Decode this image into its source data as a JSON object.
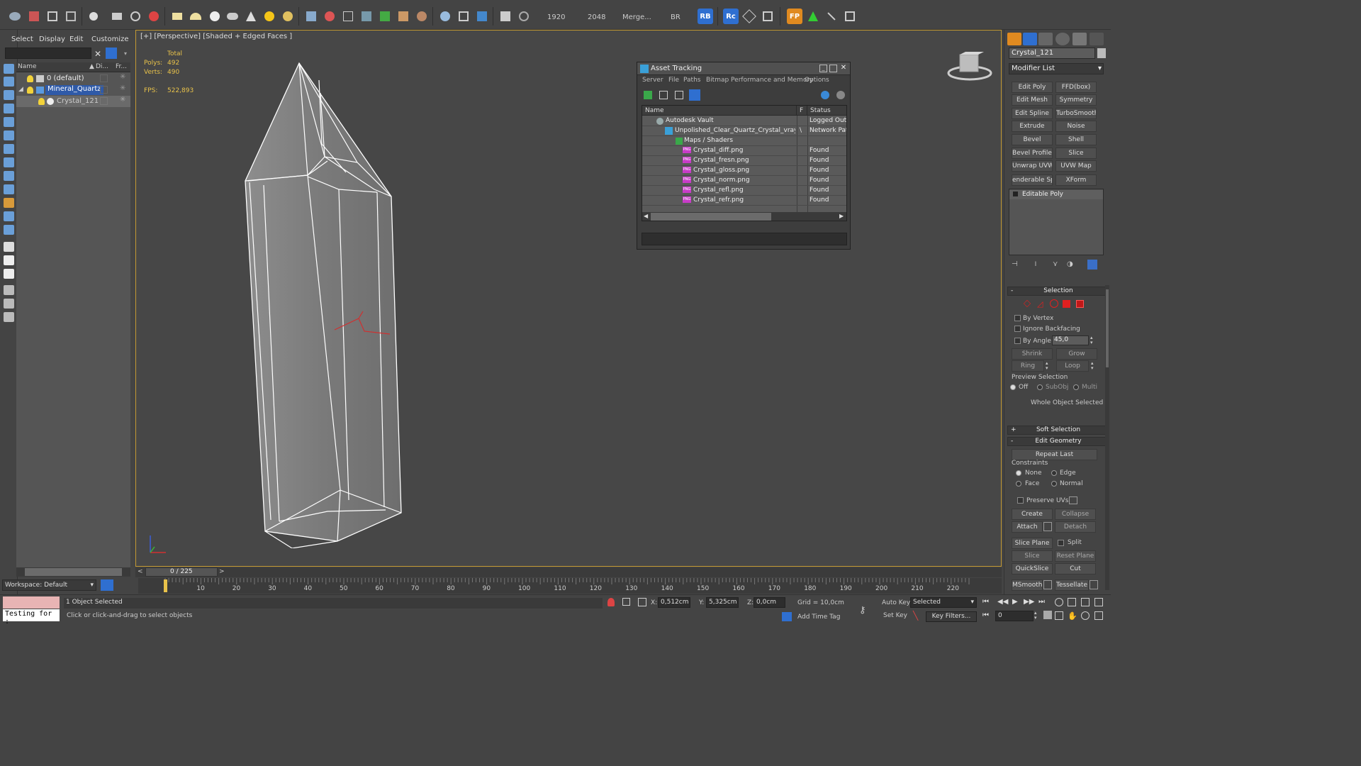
{
  "toolbar": {
    "render_width": "1920",
    "render_height": "2048",
    "merge_label": "Merge...",
    "br_label": "BR",
    "rb_label": "RB",
    "rc_label": "Rc",
    "fp_label": "FP"
  },
  "scene_explorer": {
    "menu": [
      "Select",
      "Display",
      "Edit",
      "Customize"
    ],
    "columns": {
      "name": "Name",
      "display": "Di...",
      "freeze": "Fr..."
    },
    "rows": [
      {
        "label": "0 (default)",
        "selected": false
      },
      {
        "label": "Mineral_Quartz",
        "selected": true
      },
      {
        "label": "Crystal_121",
        "selected": false
      }
    ],
    "workspace": "Workspace: Default"
  },
  "viewport": {
    "label": "[+] [Perspective] [Shaded + Edged Faces ]",
    "stats": {
      "total_label": "Total",
      "polys_label": "Polys:",
      "polys_value": "492",
      "verts_label": "Verts:",
      "verts_value": "490",
      "fps_label": "FPS:",
      "fps_value": "522,893"
    }
  },
  "asset_tracking": {
    "title": "Asset Tracking",
    "menu": [
      "Server",
      "File",
      "Paths",
      "Bitmap Performance and Memory",
      "Options"
    ],
    "columns": {
      "name": "Name",
      "flag": "F",
      "status": "Status"
    },
    "rows": [
      {
        "name": "Autodesk Vault",
        "flag": "",
        "status": "Logged Out (",
        "type": "vault"
      },
      {
        "name": "Unpolished_Clear_Quartz_Crystal_vray....",
        "flag": "\\",
        "status": "Network Path",
        "type": "max"
      },
      {
        "name": "Maps / Shaders",
        "flag": "",
        "status": "",
        "type": "folder"
      },
      {
        "name": "Crystal_diff.png",
        "flag": "",
        "status": "Found",
        "type": "png"
      },
      {
        "name": "Crystal_fresn.png",
        "flag": "",
        "status": "Found",
        "type": "png"
      },
      {
        "name": "Crystal_gloss.png",
        "flag": "",
        "status": "Found",
        "type": "png"
      },
      {
        "name": "Crystal_norm.png",
        "flag": "",
        "status": "Found",
        "type": "png"
      },
      {
        "name": "Crystal_refl.png",
        "flag": "",
        "status": "Found",
        "type": "png"
      },
      {
        "name": "Crystal_refr.png",
        "flag": "",
        "status": "Found",
        "type": "png"
      }
    ]
  },
  "command_panel": {
    "object_name": "Crystal_121",
    "modifier_list": "Modifier List",
    "modifier_buttons": [
      [
        "Edit Poly",
        "FFD(box)"
      ],
      [
        "Edit Mesh",
        "Symmetry"
      ],
      [
        "Edit Spline",
        "TurboSmooth"
      ],
      [
        "Extrude",
        "Noise"
      ],
      [
        "Bevel",
        "Shell"
      ],
      [
        "Bevel Profile",
        "Slice"
      ],
      [
        "Unwrap UVW",
        "UVW Map"
      ],
      [
        "enderable Splir",
        "XForm"
      ]
    ],
    "stack_item": "Editable Poly",
    "selection": {
      "title": "Selection",
      "by_vertex": "By Vertex",
      "ignore_backfacing": "Ignore Backfacing",
      "by_angle": "By Angle:",
      "angle_value": "45,0",
      "shrink": "Shrink",
      "grow": "Grow",
      "ring": "Ring",
      "loop": "Loop",
      "preview_selection": "Preview Selection",
      "preview_off": "Off",
      "preview_subobj": "SubObj",
      "preview_multi": "Multi",
      "whole_object": "Whole Object Selected"
    },
    "soft_selection": "Soft Selection",
    "edit_geometry": {
      "title": "Edit Geometry",
      "repeat_last": "Repeat Last",
      "constraints": "Constraints",
      "none": "None",
      "edge": "Edge",
      "face": "Face",
      "normal": "Normal",
      "preserve_uvs": "Preserve UVs",
      "create": "Create",
      "collapse": "Collapse",
      "attach": "Attach",
      "detach": "Detach",
      "slice_plane": "Slice Plane",
      "split": "Split",
      "slice": "Slice",
      "reset_plane": "Reset Plane",
      "quickslice": "QuickSlice",
      "cut": "Cut",
      "msmooth": "MSmooth",
      "tessellate": "Tessellate"
    }
  },
  "timeline": {
    "frame_counter": "0 / 225",
    "ticks": [
      "10",
      "20",
      "30",
      "40",
      "50",
      "60",
      "70",
      "80",
      "90",
      "100",
      "110",
      "120",
      "130",
      "140",
      "150",
      "160",
      "170",
      "180",
      "190",
      "200",
      "210",
      "220"
    ]
  },
  "status_bar": {
    "script_listener": "Testing for :",
    "selection_info": "1 Object Selected",
    "prompt": "Click or click-and-drag to select objects",
    "x_label": "X:",
    "x_value": "0,512cm",
    "y_label": "Y:",
    "y_value": "5,325cm",
    "z_label": "Z:",
    "z_value": "0,0cm",
    "grid": "Grid = 10,0cm",
    "add_time_tag": "Add Time Tag",
    "auto_key": "Auto Key",
    "set_key": "Set Key",
    "selected_dropdown": "Selected",
    "key_filters": "Key Filters...",
    "frame_field": "0"
  },
  "colors": {
    "viewport_border": "#c49a32",
    "selected_row": "#2f5aa8",
    "stats_text": "#e8c24a",
    "png_badge": "#c83cc8",
    "selection_red": "#e02020"
  }
}
